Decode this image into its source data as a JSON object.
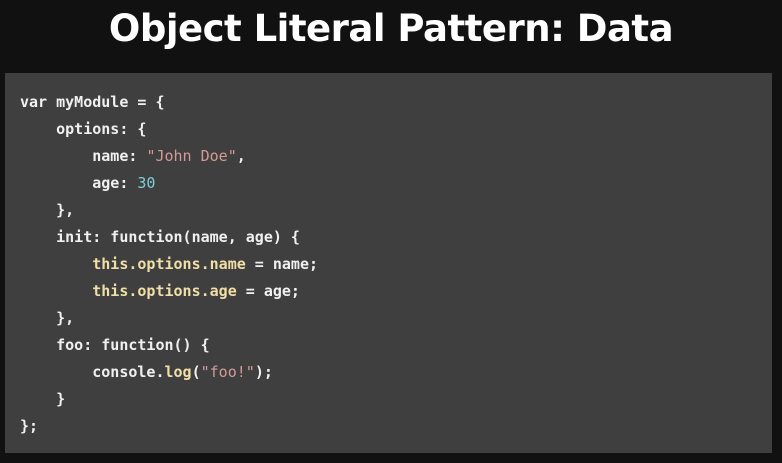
{
  "slide": {
    "title": "Object Literal Pattern: Data"
  },
  "code": {
    "lines": [
      [
        {
          "t": "var myModule = {",
          "k": "plain"
        }
      ],
      [
        {
          "t": "    options: {",
          "k": "plain"
        }
      ],
      [
        {
          "t": "        name: ",
          "k": "plain"
        },
        {
          "t": "\"John Doe\"",
          "k": "str"
        },
        {
          "t": ",",
          "k": "plain"
        }
      ],
      [
        {
          "t": "        age: ",
          "k": "plain"
        },
        {
          "t": "30",
          "k": "num"
        }
      ],
      [
        {
          "t": "    },",
          "k": "plain"
        }
      ],
      [
        {
          "t": "    init: function(name, age) {",
          "k": "plain"
        }
      ],
      [
        {
          "t": "        ",
          "k": "plain"
        },
        {
          "t": "this.options.name",
          "k": "prop"
        },
        {
          "t": " = name;",
          "k": "plain"
        }
      ],
      [
        {
          "t": "        ",
          "k": "plain"
        },
        {
          "t": "this.options.age",
          "k": "prop"
        },
        {
          "t": " = age;",
          "k": "plain"
        }
      ],
      [
        {
          "t": "    },",
          "k": "plain"
        }
      ],
      [
        {
          "t": "    foo: function() {",
          "k": "plain"
        }
      ],
      [
        {
          "t": "        console.",
          "k": "plain"
        },
        {
          "t": "log",
          "k": "prop"
        },
        {
          "t": "(",
          "k": "plain"
        },
        {
          "t": "\"foo!\"",
          "k": "str"
        },
        {
          "t": ");",
          "k": "plain"
        }
      ],
      [
        {
          "t": "    }",
          "k": "plain"
        }
      ],
      [
        {
          "t": "};",
          "k": "plain"
        }
      ]
    ]
  }
}
